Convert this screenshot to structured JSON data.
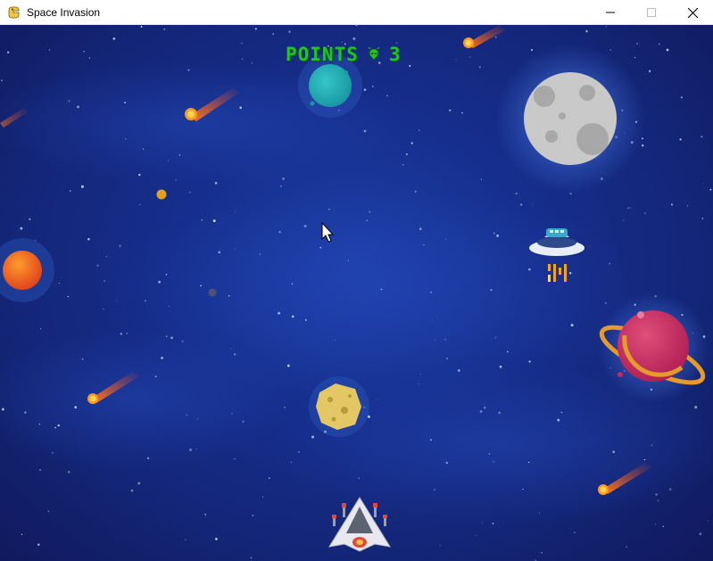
{
  "window": {
    "title": "Space Invasion",
    "icon": "pygame-snake-icon",
    "controls": [
      "minimize",
      "maximize",
      "close"
    ]
  },
  "hud": {
    "points_label": "POINTS",
    "points_value": "3",
    "points_icon": "alien-icon",
    "text_color": "#22c41f"
  },
  "scene": {
    "background_color": "#1a3596",
    "objects": [
      "player-spaceship",
      "ufo-enemy",
      "asteroid",
      "moon",
      "ringed-planet",
      "teal-planet",
      "orange-planet",
      "meteors",
      "mouse-cursor"
    ]
  }
}
